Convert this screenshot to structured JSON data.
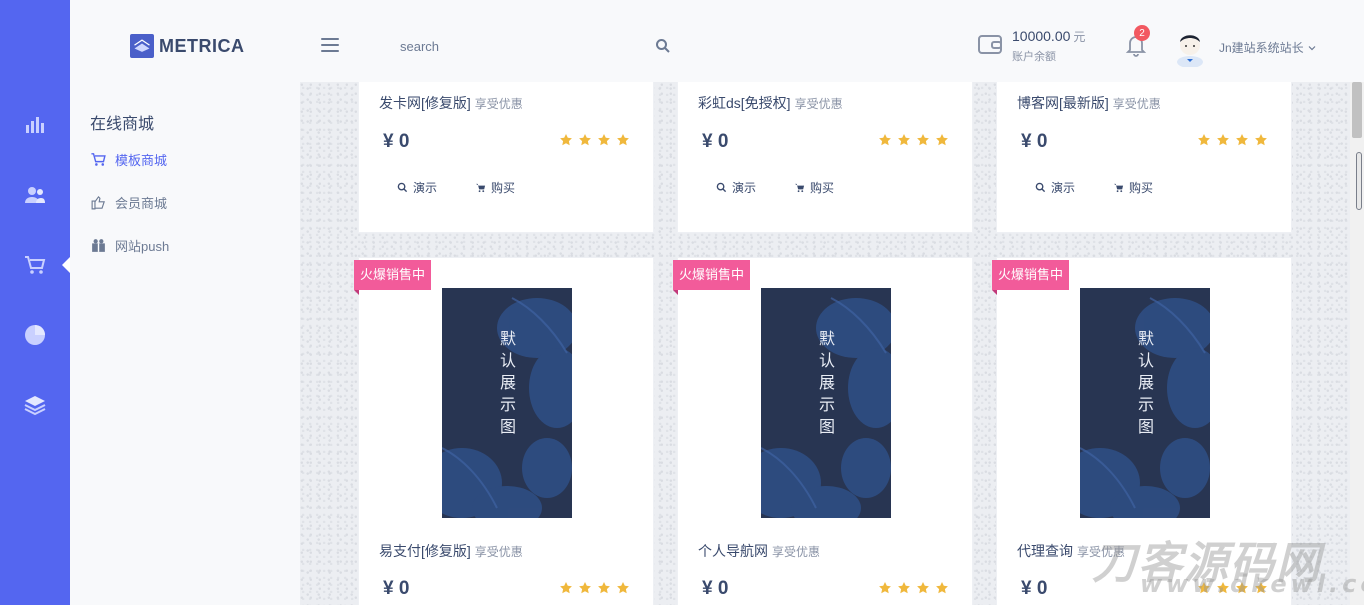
{
  "brand": {
    "name": "METRICA"
  },
  "search": {
    "placeholder": "search"
  },
  "account": {
    "balance": "10000.00",
    "currency": "元",
    "balance_label": "账户余额",
    "notifications": "2",
    "user_name": "Jn建站系统站长"
  },
  "rail": {
    "items": [
      "analytics-icon",
      "users-icon",
      "cart-icon",
      "pie-chart-icon",
      "layers-icon"
    ]
  },
  "submenu": {
    "title": "在线商城",
    "items": [
      {
        "label": "模板商城",
        "icon": "cart-icon"
      },
      {
        "label": "会员商城",
        "icon": "thumbs-up-icon"
      },
      {
        "label": "网站push",
        "icon": "gift-icon"
      }
    ]
  },
  "products": {
    "tag": "享受优惠",
    "demo_label": "演示",
    "buy_label": "购买",
    "ribbon": "火爆销售中",
    "rating": 4,
    "cover_title": "默认展示图",
    "row1": [
      {
        "name": "发卡网[修复版]",
        "price": "¥ 0"
      },
      {
        "name": "彩虹ds[免授权]",
        "price": "¥ 0"
      },
      {
        "name": "博客网[最新版]",
        "price": "¥ 0"
      }
    ],
    "row2": [
      {
        "name": "易支付[修复版]",
        "price": "¥ 0"
      },
      {
        "name": "个人导航网",
        "price": "¥ 0"
      },
      {
        "name": "代理查询",
        "price": "¥ 0"
      }
    ]
  },
  "watermark": {
    "text": "刀客源码网",
    "url": "www.dkewl.com"
  },
  "colors": {
    "primary": "#5466f0",
    "ribbon": "#f25b9a",
    "star": "#f0b83c",
    "badge": "#f25961"
  }
}
